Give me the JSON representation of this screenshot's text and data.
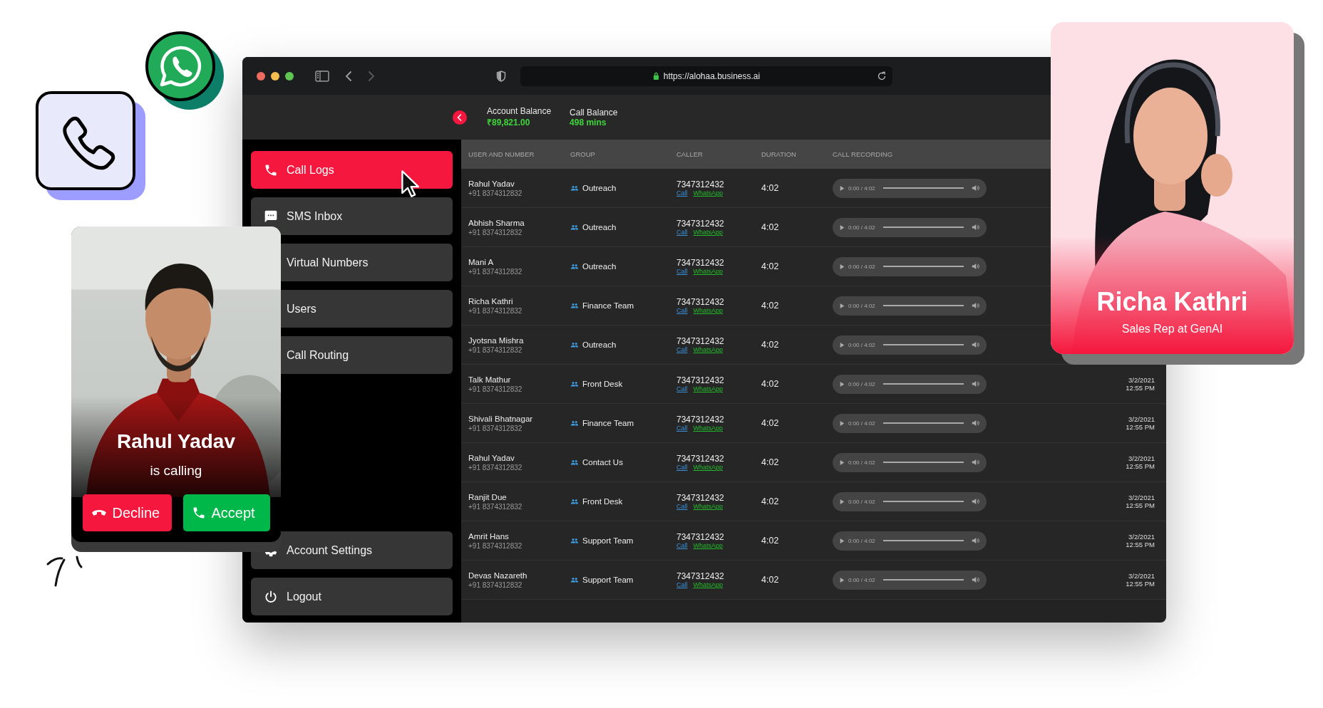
{
  "browser": {
    "url": "https://alohaa.business.ai"
  },
  "header": {
    "balances": [
      {
        "label": "Account Balance",
        "value": "₹89,821.00"
      },
      {
        "label": "Call Balance",
        "value": "498 mins"
      }
    ]
  },
  "sidebar": {
    "items": [
      {
        "label": "Call Logs",
        "selected": true
      },
      {
        "label": "SMS Inbox",
        "selected": false
      },
      {
        "label": "Virtual Numbers",
        "selected": false
      },
      {
        "label": "Users",
        "selected": false
      },
      {
        "label": "Call Routing",
        "selected": false
      }
    ],
    "bottom_items": [
      {
        "label": "Account Settings",
        "selected": false
      },
      {
        "label": "Logout",
        "selected": false
      }
    ]
  },
  "table": {
    "columns": [
      "USER AND NUMBER",
      "GROUP",
      "CALLER",
      "DURATION",
      "CALL RECORDING"
    ],
    "rows": [
      {
        "name": "Rahul Yadav",
        "number": "+91 8374312832",
        "group": "Outreach",
        "caller": "7347312432",
        "call_link": "Call",
        "whatsapp_link": "WhatsApp",
        "duration": "4:02",
        "recording": "0:00 / 4:02"
      },
      {
        "name": "Abhish Sharma",
        "number": "+91 8374312832",
        "group": "Outreach",
        "caller": "7347312432",
        "call_link": "Call",
        "whatsapp_link": "WhatsApp",
        "duration": "4:02",
        "recording": "0:00 / 4:02"
      },
      {
        "name": "Mani A",
        "number": "+91 8374312832",
        "group": "Outreach",
        "caller": "7347312432",
        "call_link": "Call",
        "whatsapp_link": "WhatsApp",
        "duration": "4:02",
        "recording": "0:00 / 4:02"
      },
      {
        "name": "Richa Kathri",
        "number": "+91 8374312832",
        "group": "Finance Team",
        "caller": "7347312432",
        "call_link": "Call",
        "whatsapp_link": "WhatsApp",
        "duration": "4:02",
        "recording": "0:00 / 4:02"
      },
      {
        "name": "Jyotsna Mishra",
        "number": "+91 8374312832",
        "group": "Outreach",
        "caller": "7347312432",
        "call_link": "Call",
        "whatsapp_link": "WhatsApp",
        "duration": "4:02",
        "recording": "0:00 / 4:02"
      },
      {
        "name": "Talk Mathur",
        "number": "+91 8374312832",
        "group": "Front Desk",
        "caller": "7347312432",
        "call_link": "Call",
        "whatsapp_link": "WhatsApp",
        "duration": "4:02",
        "recording": "0:00 / 4:02",
        "date": "3/2/2021",
        "time": "12:55 PM"
      },
      {
        "name": "Shivali Bhatnagar",
        "number": "+91 8374312832",
        "group": "Finance Team",
        "caller": "7347312432",
        "call_link": "Call",
        "whatsapp_link": "WhatsApp",
        "duration": "4:02",
        "recording": "0:00 / 4:02",
        "date": "3/2/2021",
        "time": "12:55 PM"
      },
      {
        "name": "Rahul Yadav",
        "number": "+91 8374312832",
        "group": "Contact Us",
        "caller": "7347312432",
        "call_link": "Call",
        "whatsapp_link": "WhatsApp",
        "duration": "4:02",
        "recording": "0:00 / 4:02",
        "date": "3/2/2021",
        "time": "12:55 PM"
      },
      {
        "name": "Ranjit Due",
        "number": "+91 8374312832",
        "group": "Front Desk",
        "caller": "7347312432",
        "call_link": "Call",
        "whatsapp_link": "WhatsApp",
        "duration": "4:02",
        "recording": "0:00 / 4:02",
        "date": "3/2/2021",
        "time": "12:55 PM"
      },
      {
        "name": "Amrit Hans",
        "number": "+91 8374312832",
        "group": "Support Team",
        "caller": "7347312432",
        "call_link": "Call",
        "whatsapp_link": "WhatsApp",
        "duration": "4:02",
        "recording": "0:00 / 4:02",
        "date": "3/2/2021",
        "time": "12:55 PM"
      },
      {
        "name": "Devas Nazareth",
        "number": "+91 8374312832",
        "group": "Support Team",
        "caller": "7347312432",
        "call_link": "Call",
        "whatsapp_link": "WhatsApp",
        "duration": "4:02",
        "recording": "0:00 / 4:02",
        "date": "3/2/2021",
        "time": "12:55 PM"
      }
    ]
  },
  "incoming_call": {
    "name": "Rahul Yadav",
    "status": "is calling",
    "buttons": [
      {
        "label": "Decline",
        "kind": "decline"
      },
      {
        "label": "Accept",
        "kind": "accept"
      }
    ]
  },
  "profile_card": {
    "name": "Richa Kathri",
    "role": "Sales Rep at GenAI"
  }
}
